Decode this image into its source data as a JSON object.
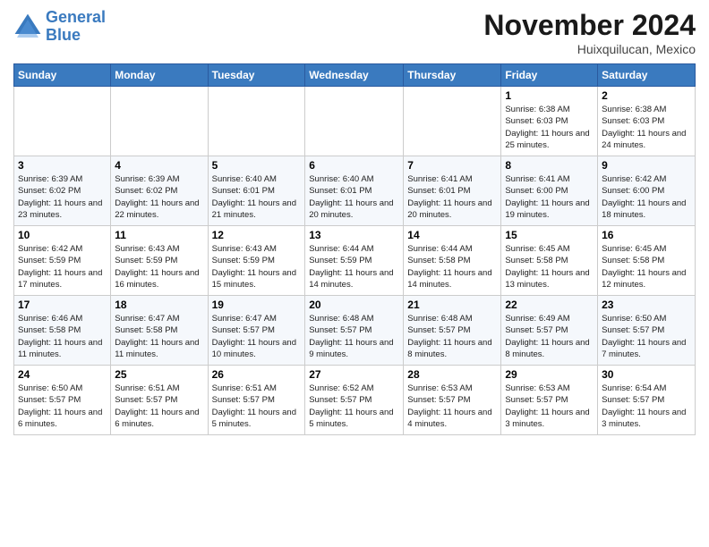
{
  "logo": {
    "line1": "General",
    "line2": "Blue"
  },
  "title": "November 2024",
  "location": "Huixquilucan, Mexico",
  "days_of_week": [
    "Sunday",
    "Monday",
    "Tuesday",
    "Wednesday",
    "Thursday",
    "Friday",
    "Saturday"
  ],
  "weeks": [
    [
      {
        "day": "",
        "info": ""
      },
      {
        "day": "",
        "info": ""
      },
      {
        "day": "",
        "info": ""
      },
      {
        "day": "",
        "info": ""
      },
      {
        "day": "",
        "info": ""
      },
      {
        "day": "1",
        "info": "Sunrise: 6:38 AM\nSunset: 6:03 PM\nDaylight: 11 hours and 25 minutes."
      },
      {
        "day": "2",
        "info": "Sunrise: 6:38 AM\nSunset: 6:03 PM\nDaylight: 11 hours and 24 minutes."
      }
    ],
    [
      {
        "day": "3",
        "info": "Sunrise: 6:39 AM\nSunset: 6:02 PM\nDaylight: 11 hours and 23 minutes."
      },
      {
        "day": "4",
        "info": "Sunrise: 6:39 AM\nSunset: 6:02 PM\nDaylight: 11 hours and 22 minutes."
      },
      {
        "day": "5",
        "info": "Sunrise: 6:40 AM\nSunset: 6:01 PM\nDaylight: 11 hours and 21 minutes."
      },
      {
        "day": "6",
        "info": "Sunrise: 6:40 AM\nSunset: 6:01 PM\nDaylight: 11 hours and 20 minutes."
      },
      {
        "day": "7",
        "info": "Sunrise: 6:41 AM\nSunset: 6:01 PM\nDaylight: 11 hours and 20 minutes."
      },
      {
        "day": "8",
        "info": "Sunrise: 6:41 AM\nSunset: 6:00 PM\nDaylight: 11 hours and 19 minutes."
      },
      {
        "day": "9",
        "info": "Sunrise: 6:42 AM\nSunset: 6:00 PM\nDaylight: 11 hours and 18 minutes."
      }
    ],
    [
      {
        "day": "10",
        "info": "Sunrise: 6:42 AM\nSunset: 5:59 PM\nDaylight: 11 hours and 17 minutes."
      },
      {
        "day": "11",
        "info": "Sunrise: 6:43 AM\nSunset: 5:59 PM\nDaylight: 11 hours and 16 minutes."
      },
      {
        "day": "12",
        "info": "Sunrise: 6:43 AM\nSunset: 5:59 PM\nDaylight: 11 hours and 15 minutes."
      },
      {
        "day": "13",
        "info": "Sunrise: 6:44 AM\nSunset: 5:59 PM\nDaylight: 11 hours and 14 minutes."
      },
      {
        "day": "14",
        "info": "Sunrise: 6:44 AM\nSunset: 5:58 PM\nDaylight: 11 hours and 14 minutes."
      },
      {
        "day": "15",
        "info": "Sunrise: 6:45 AM\nSunset: 5:58 PM\nDaylight: 11 hours and 13 minutes."
      },
      {
        "day": "16",
        "info": "Sunrise: 6:45 AM\nSunset: 5:58 PM\nDaylight: 11 hours and 12 minutes."
      }
    ],
    [
      {
        "day": "17",
        "info": "Sunrise: 6:46 AM\nSunset: 5:58 PM\nDaylight: 11 hours and 11 minutes."
      },
      {
        "day": "18",
        "info": "Sunrise: 6:47 AM\nSunset: 5:58 PM\nDaylight: 11 hours and 11 minutes."
      },
      {
        "day": "19",
        "info": "Sunrise: 6:47 AM\nSunset: 5:57 PM\nDaylight: 11 hours and 10 minutes."
      },
      {
        "day": "20",
        "info": "Sunrise: 6:48 AM\nSunset: 5:57 PM\nDaylight: 11 hours and 9 minutes."
      },
      {
        "day": "21",
        "info": "Sunrise: 6:48 AM\nSunset: 5:57 PM\nDaylight: 11 hours and 8 minutes."
      },
      {
        "day": "22",
        "info": "Sunrise: 6:49 AM\nSunset: 5:57 PM\nDaylight: 11 hours and 8 minutes."
      },
      {
        "day": "23",
        "info": "Sunrise: 6:50 AM\nSunset: 5:57 PM\nDaylight: 11 hours and 7 minutes."
      }
    ],
    [
      {
        "day": "24",
        "info": "Sunrise: 6:50 AM\nSunset: 5:57 PM\nDaylight: 11 hours and 6 minutes."
      },
      {
        "day": "25",
        "info": "Sunrise: 6:51 AM\nSunset: 5:57 PM\nDaylight: 11 hours and 6 minutes."
      },
      {
        "day": "26",
        "info": "Sunrise: 6:51 AM\nSunset: 5:57 PM\nDaylight: 11 hours and 5 minutes."
      },
      {
        "day": "27",
        "info": "Sunrise: 6:52 AM\nSunset: 5:57 PM\nDaylight: 11 hours and 5 minutes."
      },
      {
        "day": "28",
        "info": "Sunrise: 6:53 AM\nSunset: 5:57 PM\nDaylight: 11 hours and 4 minutes."
      },
      {
        "day": "29",
        "info": "Sunrise: 6:53 AM\nSunset: 5:57 PM\nDaylight: 11 hours and 3 minutes."
      },
      {
        "day": "30",
        "info": "Sunrise: 6:54 AM\nSunset: 5:57 PM\nDaylight: 11 hours and 3 minutes."
      }
    ]
  ]
}
